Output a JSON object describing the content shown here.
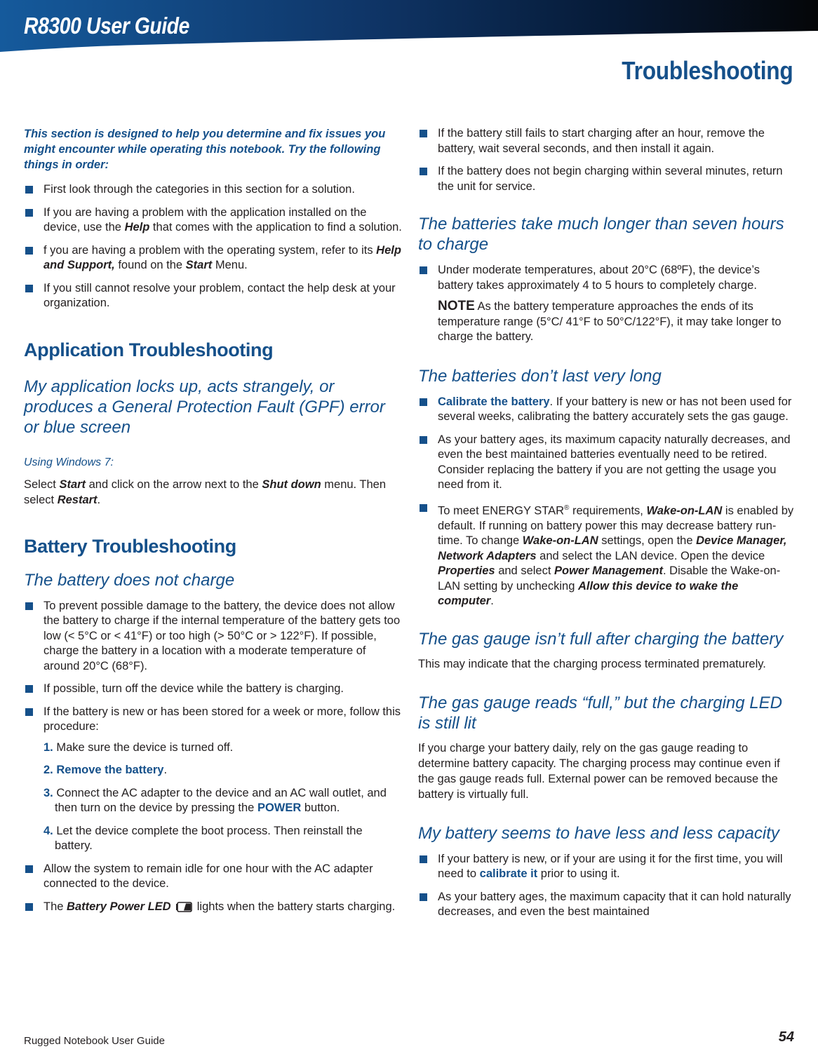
{
  "header": {
    "doc_title": "R8300 User Guide",
    "section_title": "Troubleshooting",
    "colors": {
      "banner_left": "#155a9c",
      "banner_right": "#050608",
      "accent": "#15508a"
    }
  },
  "intro": {
    "text": "This section is designed to help you determine and fix issues you might encounter while operating this notebook. Try the following things in order:",
    "bullets": [
      {
        "parts": [
          "First look through the categories in this section for a solution."
        ]
      },
      {
        "t1": "If you are having a problem with the application installed on the device, use the ",
        "em1": "Help",
        "t2": " that comes with the application to find a solution."
      },
      {
        "t1": "f you are having a problem with the operating system, refer to its ",
        "em1": "Help and Support,",
        "t2": " found on the ",
        "em2": "Start",
        "t3": " Menu."
      },
      {
        "parts": [
          "If you still cannot resolve your problem, contact the help desk at your organization."
        ]
      }
    ]
  },
  "app_section": {
    "heading": "Application Troubleshooting",
    "subheading": "My application locks up, acts strangely, or produces a General Protection Fault (GPF) error or blue screen",
    "os_label": "Using Windows 7:",
    "instruction": {
      "t1": "Select ",
      "em1": "Start",
      "t2": " and click on the arrow next to the ",
      "em2": "Shut down",
      "t3": " menu. Then select ",
      "em3": "Restart",
      "t4": "."
    }
  },
  "battery_section": {
    "heading": "Battery Troubleshooting",
    "no_charge": {
      "subheading": "The battery does not charge",
      "bullets": [
        "To prevent possible damage to the battery, the device does not allow the battery to charge if the internal temperature of the battery gets too low (< 5°C or < 41°F) or too high (> 50°C or > 122°F). If possible, charge the battery in a location with a moderate temperature of around 20°C (68°F).",
        "If possible, turn off the device while the battery is charging.",
        "If the battery is new or has been stored for a week or more, follow this procedure:"
      ],
      "steps": [
        {
          "num": "1.",
          "text": " Make sure the device is turned off."
        },
        {
          "num": "2.",
          "link": " Remove the battery",
          "text": "."
        },
        {
          "num": "3.",
          "text": " Connect the AC adapter to the device and an AC wall outlet, and then turn on the device by pressing the ",
          "link2": "POWER",
          "text2": " button."
        },
        {
          "num": "4.",
          "text": " Let the device complete the boot process. Then reinstall the battery."
        }
      ],
      "after_steps": [
        "Allow the system to remain idle for one hour with the AC adapter connected to the device."
      ],
      "led_bullet": {
        "t1": "The ",
        "em1": "Battery Power LED",
        "icon": "battery-icon",
        "t2": " lights when the battery starts charging."
      },
      "right_bullets": [
        "If the battery still fails to start charging after an hour, remove the battery, wait several seconds, and then install it again.",
        "If the battery does not begin charging within several minutes, return the unit for service."
      ]
    },
    "seven_hours": {
      "subheading": "The batteries take much longer than seven hours to charge",
      "bullet": "Under moderate temperatures, about 20°C (68ºF), the device’s battery takes approximately 4 to 5 hours to completely charge.",
      "note_label": "NOTE",
      "note_text": " As the battery temperature approaches the ends of its temperature range (5°C/ 41°F to 50°C/122°F), it may take longer to charge the battery."
    },
    "dont_last": {
      "subheading": "The batteries don’t last very long",
      "bullet1": {
        "link": "Calibrate the battery",
        "text": ". If your battery is new or has not been used for several weeks, calibrating the battery accurately sets the gas gauge."
      },
      "bullet2": "As your battery ages, its maximum capacity naturally decreases, and even the best maintained batteries eventually need to be retired. Consider replacing the battery if you are not getting the usage you need from it.",
      "bullet3": {
        "t1": "To meet ENERGY STAR",
        "sup": "®",
        "t2": " requirements, ",
        "em1": "Wake-on-LAN",
        "t3": " is enabled by default. If running on battery power this may decrease battery run-time. To change ",
        "em2": "Wake-on-LAN",
        "t4": " settings, open the ",
        "em3": "Device Manager, Network Adapters",
        "t5": " and select the LAN device. Open the device ",
        "em4": "Properties",
        "t6": " and select ",
        "em5": "Power Management",
        "t7": ". Disable the Wake-on-LAN setting by unchecking ",
        "em6": "Allow this device to wake the computer",
        "t8": "."
      }
    },
    "gauge_not_full": {
      "subheading": "The gas gauge isn’t full after charging the battery",
      "text": "This may indicate that the charging process terminated prematurely."
    },
    "gauge_full_led": {
      "subheading": "The gas gauge reads “full,” but the charging LED is still lit",
      "text": "If you charge your battery daily, rely on the gas gauge reading to determine battery capacity. The charging process may continue even if the gas gauge reads full. External power can be removed because the battery is virtually full."
    },
    "less_capacity": {
      "subheading": "My battery seems to have less and less capacity",
      "bullet1": {
        "t1": "If your battery is new, or if your are using it for the first time, you will need to ",
        "link": "calibrate it",
        "t2": " prior to using it."
      },
      "bullet2": "As your battery ages, the maximum capacity that it can hold naturally decreases, and even the best maintained"
    }
  },
  "footer": {
    "left": "Rugged Notebook User Guide",
    "page_number": "54"
  }
}
